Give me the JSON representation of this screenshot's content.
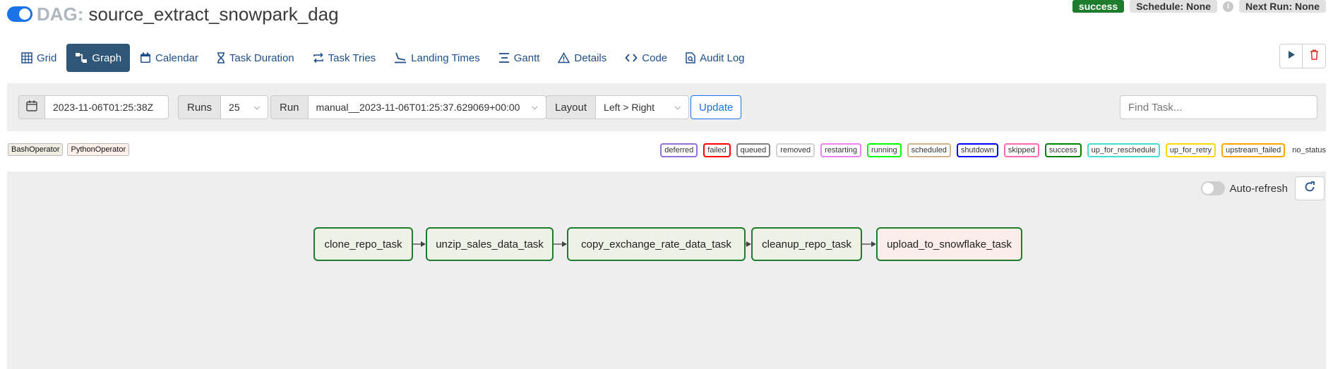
{
  "header": {
    "prefix": "DAG:",
    "dag_name": "source_extract_snowpark_dag",
    "state_badge": "success",
    "schedule": "Schedule: None",
    "next_run": "Next Run: None",
    "info_glyph": "i"
  },
  "tabs": [
    {
      "label": "Grid",
      "icon": "grid-icon"
    },
    {
      "label": "Graph",
      "icon": "graph-icon",
      "active": true
    },
    {
      "label": "Calendar",
      "icon": "calendar-icon"
    },
    {
      "label": "Task Duration",
      "icon": "hourglass-icon"
    },
    {
      "label": "Task Tries",
      "icon": "retry-icon"
    },
    {
      "label": "Landing Times",
      "icon": "landing-icon"
    },
    {
      "label": "Gantt",
      "icon": "gantt-icon"
    },
    {
      "label": "Details",
      "icon": "warning-triangle-icon"
    },
    {
      "label": "Code",
      "icon": "code-icon"
    },
    {
      "label": "Audit Log",
      "icon": "audit-log-icon"
    }
  ],
  "filters": {
    "date": "2023-11-06T01:25:38Z",
    "runs_label": "Runs",
    "runs_value": "25",
    "run_label": "Run",
    "run_value": "manual__2023-11-06T01:25:37.629069+00:00",
    "layout_label": "Layout",
    "layout_value": "Left > Right",
    "update_label": "Update",
    "find_placeholder": "Find Task..."
  },
  "operators": [
    {
      "label": "BashOperator",
      "color": "#f0ede4"
    },
    {
      "label": "PythonOperator",
      "color": "#ffefeb"
    }
  ],
  "states": [
    {
      "label": "deferred",
      "color": "#9370db"
    },
    {
      "label": "failed",
      "color": "#ff0000"
    },
    {
      "label": "queued",
      "color": "#808080"
    },
    {
      "label": "removed",
      "color": "#d3d3d3"
    },
    {
      "label": "restarting",
      "color": "#ee82ee"
    },
    {
      "label": "running",
      "color": "#00ff00"
    },
    {
      "label": "scheduled",
      "color": "#d2b48c"
    },
    {
      "label": "shutdown",
      "color": "#0000ff"
    },
    {
      "label": "skipped",
      "color": "#ff69b4"
    },
    {
      "label": "success",
      "color": "#008000"
    },
    {
      "label": "up_for_reschedule",
      "color": "#40e0d0"
    },
    {
      "label": "up_for_retry",
      "color": "#ffd700"
    },
    {
      "label": "upstream_failed",
      "color": "#ffa500"
    }
  ],
  "no_status_label": "no_status",
  "graph": {
    "autorefresh_label": "Auto-refresh",
    "tasks": [
      {
        "label": "clone_repo_task",
        "operator": "BashOperator",
        "state": "success"
      },
      {
        "label": "unzip_sales_data_task",
        "operator": "BashOperator",
        "state": "success"
      },
      {
        "label": "copy_exchange_rate_data_task",
        "operator": "BashOperator",
        "state": "success"
      },
      {
        "label": "cleanup_repo_task",
        "operator": "BashOperator",
        "state": "success"
      },
      {
        "label": "upload_to_snowflake_task",
        "operator": "PythonOperator",
        "state": "success"
      }
    ]
  },
  "colors": {
    "accent": "#1a73e8",
    "active_tab": "#2f5577",
    "success": "#1e7d2d"
  }
}
